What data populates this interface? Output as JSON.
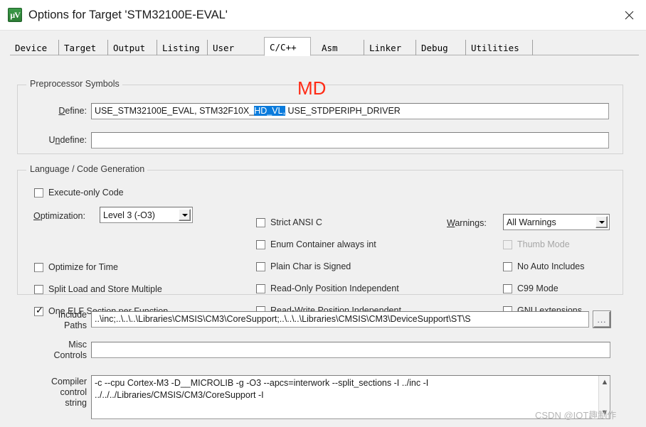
{
  "window": {
    "title": "Options for Target 'STM32100E-EVAL'",
    "icon": "keil-uvision-icon",
    "close_label": "close-icon"
  },
  "tabs": [
    {
      "label": "Device",
      "active": false
    },
    {
      "label": "Target",
      "active": false
    },
    {
      "label": "Output",
      "active": false
    },
    {
      "label": "Listing",
      "active": false
    },
    {
      "label": "User",
      "active": false
    },
    {
      "label": "C/C++",
      "active": true
    },
    {
      "label": "Asm",
      "active": false
    },
    {
      "label": "Linker",
      "active": false
    },
    {
      "label": "Debug",
      "active": false
    },
    {
      "label": "Utilities",
      "active": false
    }
  ],
  "preprocessor": {
    "group_label": "Preprocessor Symbols",
    "define_label": "Define:",
    "define_prefix": "USE_STM32100E_EVAL, STM32F10X_",
    "define_selected": "HD_VL,",
    "define_suffix": " USE_STDPERIPH_DRIVER",
    "undefine_label": "Undefine:",
    "undefine_value": ""
  },
  "annotation": {
    "md_text": "MD",
    "md_color": "#ff2b16"
  },
  "language": {
    "group_label": "Language / Code Generation",
    "left_column": [
      {
        "label": "Execute-only Code",
        "checked": false,
        "disabled": false
      },
      {
        "label": "Optimize for Time",
        "checked": false,
        "disabled": false
      },
      {
        "label": "Split Load and Store Multiple",
        "checked": false,
        "disabled": false
      },
      {
        "label": "One ELF Section per Function",
        "checked": true,
        "disabled": false
      }
    ],
    "optimization_label": "Optimization:",
    "optimization_value": "Level 3 (-O3)",
    "middle_column": [
      {
        "label": "Strict ANSI C",
        "checked": false,
        "disabled": false
      },
      {
        "label": "Enum Container always int",
        "checked": false,
        "disabled": false
      },
      {
        "label": "Plain Char is Signed",
        "checked": false,
        "disabled": false
      },
      {
        "label": "Read-Only Position Independent",
        "checked": false,
        "disabled": false
      },
      {
        "label": "Read-Write Position Independent",
        "checked": false,
        "disabled": false
      }
    ],
    "warnings_label": "Warnings:",
    "warnings_value": "All Warnings",
    "right_column": [
      {
        "label": "Thumb Mode",
        "checked": false,
        "disabled": true
      },
      {
        "label": "No Auto Includes",
        "checked": false,
        "disabled": false
      },
      {
        "label": "C99 Mode",
        "checked": false,
        "disabled": false
      },
      {
        "label": "GNU extensions",
        "checked": false,
        "disabled": false
      }
    ]
  },
  "paths": {
    "include_label_line1": "Include",
    "include_label_line2": "Paths",
    "include_value": "..\\inc;..\\..\\..\\Libraries\\CMSIS\\CM3\\CoreSupport;..\\..\\..\\Libraries\\CMSIS\\CM3\\DeviceSupport\\ST\\S",
    "browse_label": "...",
    "misc_label_line1": "Misc",
    "misc_label_line2": "Controls",
    "misc_value": ""
  },
  "compiler": {
    "label_line1": "Compiler",
    "label_line2": "control",
    "label_line3": "string",
    "line1": "-c --cpu Cortex-M3 -D__MICROLIB -g -O3 --apcs=interwork --split_sections -I ../inc -I",
    "line2": "../../../Libraries/CMSIS/CM3/CoreSupport -I",
    "scroll_up": "▲",
    "scroll_down": "▼"
  },
  "watermark": {
    "text": "CSDN @IOT趣制作"
  }
}
